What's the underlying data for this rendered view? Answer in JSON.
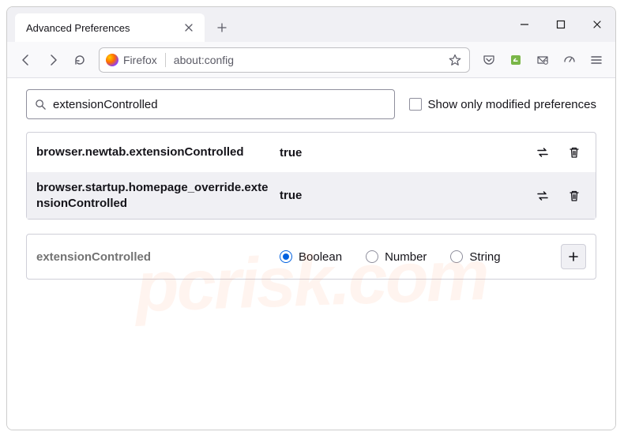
{
  "tab": {
    "title": "Advanced Preferences"
  },
  "urlbar": {
    "identity": "Firefox",
    "url": "about:config"
  },
  "search": {
    "value": "extensionControlled",
    "checkbox_label": "Show only modified preferences"
  },
  "prefs": [
    {
      "name": "browser.newtab.extensionControlled",
      "value": "true"
    },
    {
      "name": "browser.startup.homepage_override.extensionControlled",
      "value": "true"
    }
  ],
  "newpref": {
    "name": "extensionControlled",
    "types": [
      "Boolean",
      "Number",
      "String"
    ],
    "selected": "Boolean"
  },
  "watermark": "pcrisk.com"
}
